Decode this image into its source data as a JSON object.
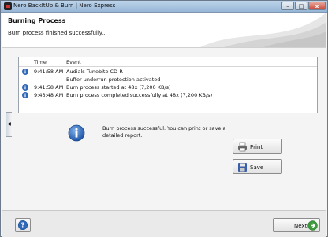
{
  "window": {
    "title": "Nero BackItUp & Burn | Nero Express",
    "controls": {
      "minimize": "–",
      "maximize": "□",
      "close": "x"
    }
  },
  "header": {
    "title": "Burning Process",
    "subtitle": "Burn process finished successfully..."
  },
  "log": {
    "columns": {
      "time": "Time",
      "event": "Event"
    },
    "rows": [
      {
        "time": "9:41:58 AM",
        "event": "Audials Tunebite CD-R",
        "icon": "info-icon"
      },
      {
        "time": "",
        "event": "Buffer underrun protection activated",
        "icon": ""
      },
      {
        "time": "9:41:58 AM",
        "event": "Burn process started at 48x (7,200 KB/s)",
        "icon": "info-icon"
      },
      {
        "time": "9:43:48 AM",
        "event": "Burn process completed successfully at 48x (7,200 KB/s)",
        "icon": "info-icon"
      }
    ]
  },
  "message": {
    "line1": "Burn process successful. You can print or save a",
    "line2": "detailed report."
  },
  "buttons": {
    "print": "Print",
    "save": "Save",
    "next": "Next"
  },
  "colors": {
    "info_blue": "#2f68b8",
    "next_green": "#3c9a3c",
    "title_bar": "#a9c4e0"
  }
}
